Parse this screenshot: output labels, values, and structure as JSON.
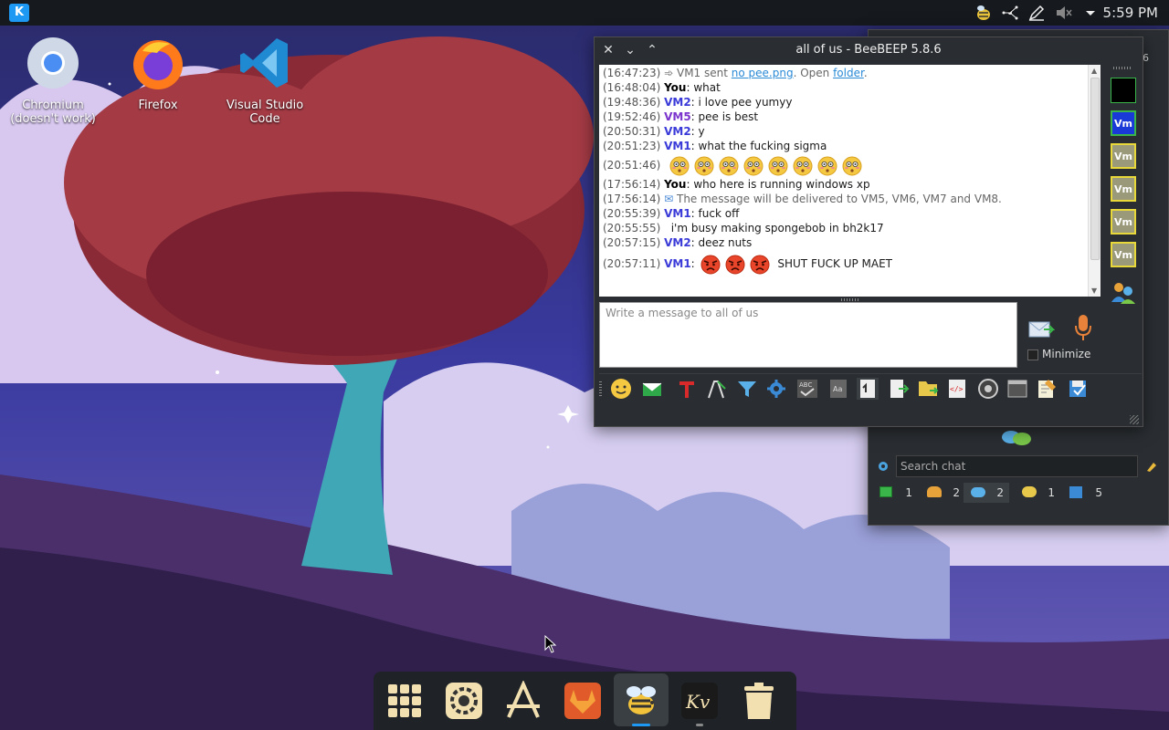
{
  "panel": {
    "clock": "5:59 PM",
    "tray_icons": [
      "beebeep-tray-icon",
      "kdeconnect-icon",
      "pen-icon",
      "muted-speaker-icon",
      "chevron-down-icon"
    ]
  },
  "desktop_icons": [
    {
      "label": "Chromium (doesn't work)",
      "icon": "chromium-icon"
    },
    {
      "label": "Firefox",
      "icon": "firefox-icon"
    },
    {
      "label": "Visual Studio Code",
      "icon": "vscode-icon"
    }
  ],
  "chat_window": {
    "title": "all of us - BeeBEEP 5.8.6",
    "messages": [
      {
        "time": "(16:47:23)",
        "sender": "",
        "system": true,
        "prefix": "VM1 sent ",
        "link1": "no pee.png",
        "mid": ". Open ",
        "link2": "folder",
        "suffix": "."
      },
      {
        "time": "(16:48:04)",
        "sender": "You",
        "text": ": what"
      },
      {
        "time": "(19:48:36)",
        "sender": "VM2",
        "text": ": i love pee yumyy"
      },
      {
        "time": "(19:52:46)",
        "sender": "VM5",
        "text": ": pee is best"
      },
      {
        "time": "(20:50:31)",
        "sender": "VM2",
        "text": ": y"
      },
      {
        "time": "(20:51:23)",
        "sender": "VM1",
        "text": ": what the fucking sigma"
      },
      {
        "time": "(20:51:46)",
        "sender": "",
        "emojis": 8,
        "emoji_type": "flushed-face-icon"
      },
      {
        "time": "(17:56:14)",
        "sender": "You",
        "text": ": who here is running windows xp"
      },
      {
        "time": "(17:56:14)",
        "sender": "",
        "system": true,
        "text": "The message will be delivered to VM5, VM6, VM7 and VM8."
      },
      {
        "time": "(20:55:39)",
        "sender": "VM1",
        "text": ": fuck off"
      },
      {
        "time": "(20:55:55)",
        "sender": "",
        "text": "i'm busy making spongebob in bh2k17"
      },
      {
        "time": "(20:57:15)",
        "sender": "VM2",
        "text": ": deez nuts"
      },
      {
        "time": "(20:57:11)",
        "sender": "VM1",
        "text": ":",
        "emojis": 3,
        "emoji_type": "angry-face-icon",
        "after": "SHUT FUCK UP MAET"
      }
    ],
    "input_placeholder": "Write a message to all of us",
    "minimize_label": "Minimize",
    "users": [
      "Vm",
      "Vm",
      "Vm",
      "Vm",
      "Vm"
    ]
  },
  "bg_window": {
    "search_placeholder": "Search chat",
    "tabs": [
      {
        "icon": "users-online-icon",
        "count": "1"
      },
      {
        "icon": "groups-icon",
        "count": "2"
      },
      {
        "icon": "chats-icon",
        "count": "2"
      },
      {
        "icon": "network-icon",
        "count": "1"
      },
      {
        "icon": "files-icon",
        "count": "5"
      }
    ]
  },
  "dock": {
    "items": [
      "app-grid-icon",
      "settings-icon",
      "text-editor-icon",
      "gitlab-icon",
      "beebeep-icon",
      "kvantum-icon",
      "trash-icon"
    ]
  },
  "colors": {
    "accent": "#1d99f3",
    "vm_name": "#3a3ad8",
    "vm5_name": "#7a33cc"
  }
}
